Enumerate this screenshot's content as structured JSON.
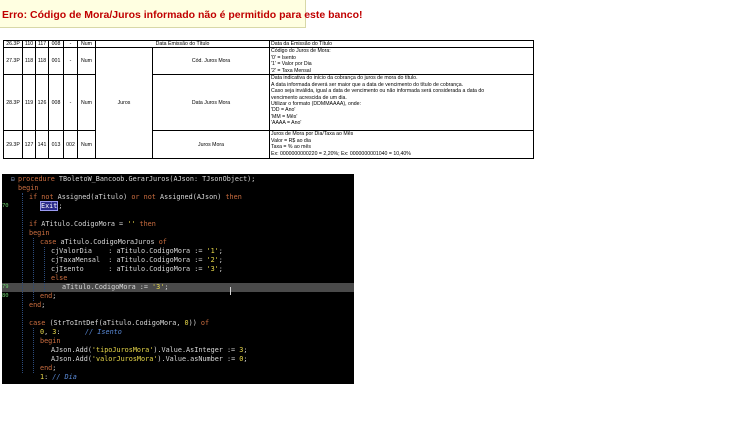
{
  "error_banner": {
    "text": "Erro: Código de Mora/Juros informado não é permitido para este banco!"
  },
  "spec_table": {
    "rows": [
      {
        "seq": "26.3P",
        "ini": "110",
        "fim": "117",
        "dig": "008",
        "dec": "-",
        "tipo": "Num",
        "grupo": "",
        "campo": "Data Emissão do Título",
        "desc": [
          "Data da Emissão do Título"
        ]
      },
      {
        "seq": "27.3P",
        "ini": "118",
        "fim": "118",
        "dig": "001",
        "dec": "-",
        "tipo": "Num",
        "grupo": "",
        "campo": "Cód. Juros Mora",
        "desc": [
          "Código do Juros de Mora:",
          "'0' = Isento",
          "'1' = Valor por Dia",
          "'2' = Taxa Mensal"
        ]
      },
      {
        "seq": "28.3P",
        "ini": "119",
        "fim": "126",
        "dig": "008",
        "dec": "-",
        "tipo": "Num",
        "grupo": "Juros",
        "campo": "Data Juros Mora",
        "desc": [
          "Data indicativa do início da cobrança do juros de mora do título.",
          "A data informada deverá ser maior que a data de vencimento do título de cobrança.",
          "Caso seja inválida, igual a data de vencimento ou não informada será considerada a data do",
          "vencimento acrescida de um dia.",
          "Utilizar o formato (DDMMAAAA), onde:",
          "'DD = Ano'",
          "'MM = Mês'",
          "'AAAA = Ano'"
        ]
      },
      {
        "seq": "29.3P",
        "ini": "127",
        "fim": "141",
        "dig": "013",
        "dec": "002",
        "tipo": "Num",
        "grupo": "",
        "campo": "Juros Mora",
        "desc": [
          "Juros de Mora por Dia/Taxa ao Mês",
          "Valor = R$ ao dia",
          "Taxa = % ao mês",
          "Ex: 0000000000220 = 2,20%; Ex: 0000000001040 = 10,40%"
        ]
      }
    ]
  },
  "editor": {
    "lines": [
      {
        "ln": "",
        "indent": 0,
        "tokens": [
          [
            "kw",
            "procedure "
          ],
          [
            "id",
            "TBoletoW_Bancoob.GerarJuros(AJson: TJsonObject);"
          ]
        ]
      },
      {
        "ln": "",
        "indent": 0,
        "tokens": [
          [
            "kw",
            "begin"
          ]
        ]
      },
      {
        "ln": "",
        "indent": 1,
        "tokens": [
          [
            "kw",
            "if not "
          ],
          [
            "id",
            "Assigned(aTitulo) "
          ],
          [
            "kw",
            "or not "
          ],
          [
            "id",
            "Assigned(AJson) "
          ],
          [
            "kw",
            "then"
          ]
        ]
      },
      {
        "ln": "70",
        "indent": 2,
        "tokens": [
          [
            "exit",
            "Exit"
          ],
          [
            "id",
            ";"
          ]
        ]
      },
      {
        "ln": "",
        "indent": 0,
        "tokens": []
      },
      {
        "ln": "",
        "indent": 1,
        "tokens": [
          [
            "kw",
            "if "
          ],
          [
            "id",
            "ATitulo.CodigoMora = "
          ],
          [
            "str",
            "''"
          ],
          [
            "id",
            " "
          ],
          [
            "kw",
            "then"
          ]
        ]
      },
      {
        "ln": "",
        "indent": 1,
        "tokens": [
          [
            "kw",
            "begin"
          ]
        ]
      },
      {
        "ln": "",
        "indent": 2,
        "tokens": [
          [
            "kw",
            "case "
          ],
          [
            "id",
            "aTitulo.CodigoMoraJuros "
          ],
          [
            "kw",
            "of"
          ]
        ]
      },
      {
        "ln": "",
        "indent": 3,
        "tokens": [
          [
            "id",
            "cjValorDia    : aTitulo.CodigoMora := "
          ],
          [
            "str",
            "'1'"
          ],
          [
            "id",
            ";"
          ]
        ]
      },
      {
        "ln": "",
        "indent": 3,
        "tokens": [
          [
            "id",
            "cjTaxaMensal  : aTitulo.CodigoMora := "
          ],
          [
            "str",
            "'2'"
          ],
          [
            "id",
            ";"
          ]
        ]
      },
      {
        "ln": "",
        "indent": 3,
        "tokens": [
          [
            "id",
            "cjIsento      : aTitulo.CodigoMora := "
          ],
          [
            "str",
            "'3'"
          ],
          [
            "id",
            ";"
          ]
        ]
      },
      {
        "ln": "",
        "indent": 3,
        "tokens": [
          [
            "kw",
            "else"
          ]
        ]
      },
      {
        "ln": "79",
        "indent": 4,
        "hl": true,
        "tokens": [
          [
            "id",
            "aTitulo.CodigoMora := "
          ],
          [
            "str",
            "'3'"
          ],
          [
            "id",
            ";"
          ]
        ]
      },
      {
        "ln": "80",
        "indent": 2,
        "tokens": [
          [
            "kw",
            "end"
          ],
          [
            "id",
            ";"
          ]
        ]
      },
      {
        "ln": "",
        "indent": 1,
        "tokens": [
          [
            "kw",
            "end"
          ],
          [
            "id",
            ";"
          ]
        ]
      },
      {
        "ln": "",
        "indent": 0,
        "tokens": []
      },
      {
        "ln": "",
        "indent": 1,
        "tokens": [
          [
            "kw",
            "case "
          ],
          [
            "id",
            "(StrToIntDef(aTitulo.CodigoMora, "
          ],
          [
            "num",
            "0"
          ],
          [
            "id",
            ")) "
          ],
          [
            "kw",
            "of"
          ]
        ]
      },
      {
        "ln": "",
        "indent": 2,
        "tokens": [
          [
            "num",
            "0"
          ],
          [
            "id",
            ", "
          ],
          [
            "num",
            "3"
          ],
          [
            "id",
            ":      "
          ],
          [
            "cmt",
            "// Isento"
          ]
        ]
      },
      {
        "ln": "",
        "indent": 2,
        "tokens": [
          [
            "kw",
            "begin"
          ]
        ]
      },
      {
        "ln": "",
        "indent": 3,
        "tokens": [
          [
            "id",
            "AJson.Add("
          ],
          [
            "str",
            "'tipoJurosMora'"
          ],
          [
            "id",
            ").Value.AsInteger := "
          ],
          [
            "num",
            "3"
          ],
          [
            "id",
            ";"
          ]
        ]
      },
      {
        "ln": "",
        "indent": 3,
        "tokens": [
          [
            "id",
            "AJson.Add("
          ],
          [
            "str",
            "'valorJurosMora'"
          ],
          [
            "id",
            ").Value.asNumber := "
          ],
          [
            "num",
            "0"
          ],
          [
            "id",
            ";"
          ]
        ]
      },
      {
        "ln": "",
        "indent": 2,
        "tokens": [
          [
            "kw",
            "end"
          ],
          [
            "id",
            ";"
          ]
        ]
      },
      {
        "ln": "",
        "indent": 2,
        "tokens": [
          [
            "num",
            "1"
          ],
          [
            "id",
            ": "
          ],
          [
            "cmt",
            "// Dia"
          ]
        ]
      }
    ]
  }
}
